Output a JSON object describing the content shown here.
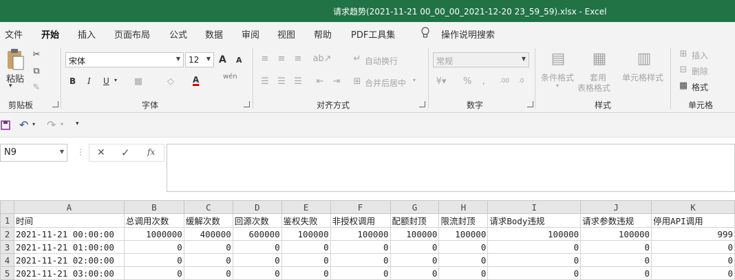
{
  "window": {
    "title": "请求趋势(2021-11-21 00_00_00_2021-12-20 23_59_59).xlsx  -  Excel"
  },
  "menu": {
    "tabs": [
      "文件",
      "开始",
      "插入",
      "页面布局",
      "公式",
      "数据",
      "审阅",
      "视图",
      "帮助",
      "PDF工具集"
    ],
    "active": "开始",
    "search_label": "操作说明搜索"
  },
  "ribbon": {
    "clipboard": {
      "paste": "粘贴",
      "label": "剪贴板"
    },
    "font": {
      "name": "宋体",
      "size": "12",
      "bold": "B",
      "italic": "I",
      "underline": "U",
      "grow": "A",
      "shrink": "A",
      "font_color": "A",
      "phonetic": "wén",
      "label": "字体"
    },
    "alignment": {
      "wrap": "自动换行",
      "merge": "合并后居中",
      "label": "对齐方式"
    },
    "number": {
      "format": "常规",
      "percent": "%",
      "label": "数字"
    },
    "styles": {
      "conditional": "条件格式",
      "table_line1": "套用",
      "table_line2": "表格格式",
      "cell_styles": "单元格样式",
      "label": "样式"
    },
    "cells": {
      "insert": "插入",
      "delete": "删除",
      "format": "格式",
      "label": "单元格"
    }
  },
  "formula_bar": {
    "name_box": "N9",
    "cancel": "✕",
    "enter": "✓",
    "fx": "fx",
    "value": ""
  },
  "sheet": {
    "columns": [
      "A",
      "B",
      "C",
      "D",
      "E",
      "F",
      "G",
      "H",
      "I",
      "J",
      "K"
    ],
    "rows": [
      {
        "num": "1",
        "cells": [
          "时间",
          "总调用次数",
          "缓解次数",
          "回源次数",
          "鉴权失败",
          "非授权调用",
          "配额封顶",
          "限流封顶",
          "请求Body违规",
          "请求参数违规",
          "停用API调用"
        ]
      },
      {
        "num": "2",
        "cells": [
          "2021-11-21 00:00:00",
          "1000000",
          "400000",
          "600000",
          "100000",
          "100000",
          "100000",
          "100000",
          "100000",
          "100000",
          "999"
        ]
      },
      {
        "num": "3",
        "cells": [
          "2021-11-21 01:00:00",
          "0",
          "0",
          "0",
          "0",
          "0",
          "0",
          "0",
          "0",
          "0",
          "0"
        ]
      },
      {
        "num": "4",
        "cells": [
          "2021-11-21 02:00:00",
          "0",
          "0",
          "0",
          "0",
          "0",
          "0",
          "0",
          "0",
          "0",
          "0"
        ]
      },
      {
        "num": "5",
        "cells": [
          "2021-11-21 03:00:00",
          "0",
          "0",
          "0",
          "0",
          "0",
          "0",
          "0",
          "0",
          "0",
          "0"
        ]
      }
    ]
  },
  "colors": {
    "accent": "#217346",
    "font_color_bar": "#e00000",
    "save_icon": "#7a2e8e"
  }
}
